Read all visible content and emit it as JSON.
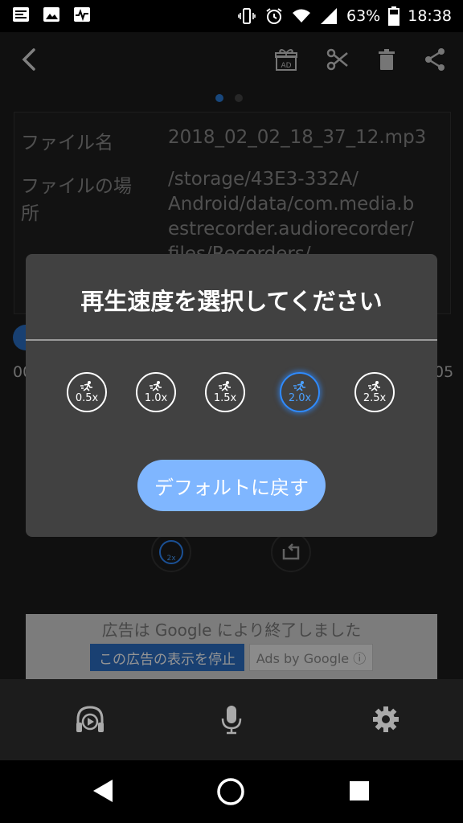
{
  "status_bar": {
    "battery_percent": "63%",
    "time": "18:38"
  },
  "pager": {
    "pages": 2,
    "active": 1
  },
  "file_info": {
    "name_label": "ファイル名",
    "name_value": "2018_02_02_18_37_12.mp3",
    "location_label_line1": "ファイルの場",
    "location_label_line2": "所",
    "location_line1": "/storage/43E3-332A/",
    "location_line2": "Android/data/com.media.b",
    "location_line3": "estrecorder.audiorecorder/",
    "location_line4": "files/Recorders/"
  },
  "player": {
    "time_start_partial": "00",
    "time_end_partial": "05",
    "speed_badge": "2x"
  },
  "dialog": {
    "title": "再生速度を選択してください",
    "speeds": [
      "0.5x",
      "1.0x",
      "1.5x",
      "2.0x",
      "2.5x"
    ],
    "selected_speed": "2.0x",
    "reset_label": "デフォルトに戻す"
  },
  "ad": {
    "message": "広告は Google により終了しました",
    "stop_label": "この広告の表示を停止",
    "ads_by_label": "Ads by Google ⓘ"
  },
  "colors": {
    "accent": "#2f8bff",
    "reset_button": "#7fb6ff",
    "dialog_bg": "#414141"
  }
}
